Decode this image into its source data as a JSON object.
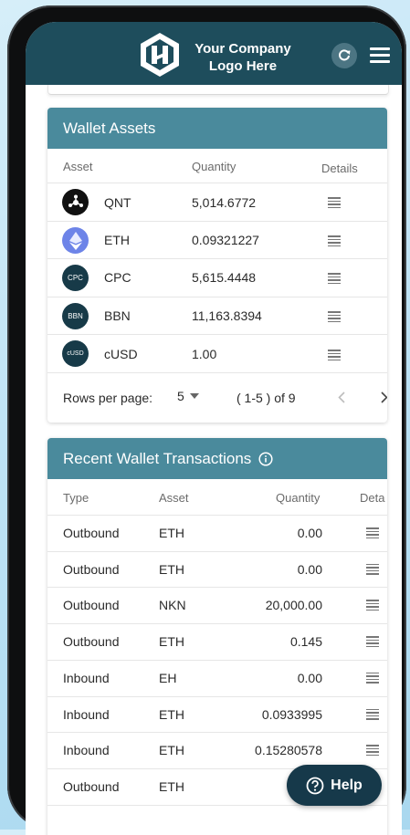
{
  "header": {
    "logo_line1": "Your Company",
    "logo_line2": "Logo Here",
    "brand_color": "#1e4d5c"
  },
  "wallet_assets": {
    "title": "Wallet Assets",
    "columns": [
      "Asset",
      "Quantity",
      "Details"
    ],
    "rows": [
      {
        "symbol": "QNT",
        "quantity": "5,014.6772",
        "icon": "qnt-icon"
      },
      {
        "symbol": "ETH",
        "quantity": "0.09321227",
        "icon": "eth-icon"
      },
      {
        "symbol": "CPC",
        "quantity": "5,615.4448",
        "icon": "cpc-icon",
        "badge": "CPC"
      },
      {
        "symbol": "BBN",
        "quantity": "11,163.8394",
        "icon": "bbn-icon",
        "badge": "BBN"
      },
      {
        "symbol": "cUSD",
        "quantity": "1.00",
        "icon": "cusd-icon",
        "badge": "cUSD"
      }
    ],
    "pagination": {
      "rows_per_page_label": "Rows per page:",
      "rows_per_page": "5",
      "range": "( 1-5 ) of 9"
    }
  },
  "recent_transactions": {
    "title": "Recent Wallet Transactions",
    "columns": [
      "Type",
      "Asset",
      "Quantity",
      "Deta"
    ],
    "rows": [
      {
        "type": "Outbound",
        "asset": "ETH",
        "quantity": "0.00"
      },
      {
        "type": "Outbound",
        "asset": "ETH",
        "quantity": "0.00"
      },
      {
        "type": "Outbound",
        "asset": "NKN",
        "quantity": "20,000.00"
      },
      {
        "type": "Outbound",
        "asset": "ETH",
        "quantity": "0.145"
      },
      {
        "type": "Inbound",
        "asset": "EH",
        "quantity": "0.00"
      },
      {
        "type": "Inbound",
        "asset": "ETH",
        "quantity": "0.0933995"
      },
      {
        "type": "Inbound",
        "asset": "ETH",
        "quantity": "0.15280578"
      },
      {
        "type": "Outbound",
        "asset": "ETH",
        "quantity": ""
      }
    ]
  },
  "help_button": {
    "label": "Help"
  }
}
